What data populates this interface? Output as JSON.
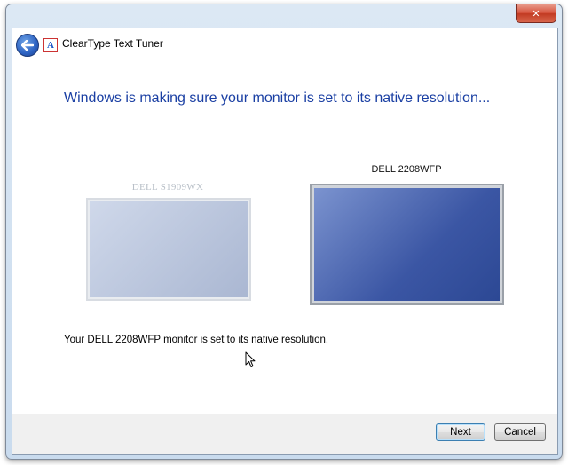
{
  "window": {
    "title": "ClearType Text Tuner"
  },
  "titlebar": {
    "close_glyph": "✕"
  },
  "app_icon": {
    "glyph": "A"
  },
  "main": {
    "heading": "Windows is making sure your monitor is set to its native resolution...",
    "monitors": [
      {
        "name": "DELL S1909WX",
        "active": false
      },
      {
        "name": "DELL 2208WFP",
        "active": true
      }
    ],
    "status": "Your DELL 2208WFP monitor is set to its native resolution."
  },
  "footer": {
    "next_label": "Next",
    "cancel_label": "Cancel"
  },
  "colors": {
    "heading": "#1a3fa3",
    "close": "#c23a22",
    "accent": "#2c62c2"
  },
  "icons": {
    "back": "back-arrow-icon",
    "close": "close-icon",
    "app": "cleartype-icon",
    "cursor": "mouse-cursor-icon"
  }
}
